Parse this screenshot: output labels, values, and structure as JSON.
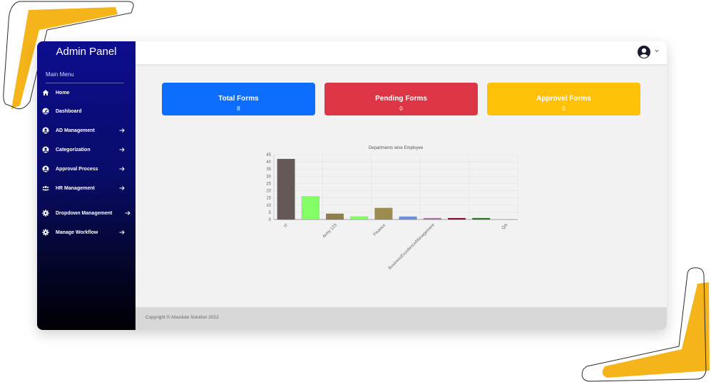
{
  "sidebar": {
    "brand": "Admin Panel",
    "menu_heading": "Main Menu",
    "items": [
      {
        "label": "Home",
        "icon": "home-icon",
        "has_arrow": false
      },
      {
        "label": "Dashboard",
        "icon": "dashboard-icon",
        "has_arrow": false
      },
      {
        "label": "AD Management",
        "icon": "user-circle-icon",
        "has_arrow": true
      },
      {
        "label": "Categorization",
        "icon": "user-circle-icon",
        "has_arrow": true
      },
      {
        "label": "Approval Process",
        "icon": "user-circle-icon",
        "has_arrow": true
      },
      {
        "label": "HR Management",
        "icon": "users-icon",
        "has_arrow": true
      },
      {
        "label": "Dropdown Management",
        "icon": "gear-icon",
        "has_arrow": true
      },
      {
        "label": "Manage Workflow",
        "icon": "gear-icon",
        "has_arrow": true
      }
    ]
  },
  "cards": [
    {
      "title": "Total Forms",
      "count": "8",
      "color": "#0d6efd"
    },
    {
      "title": "Pending Forms",
      "count": "0",
      "color": "#dc3545"
    },
    {
      "title": "Approvel Forms",
      "count": "0",
      "color": "#ffc107"
    }
  ],
  "chart_data": {
    "type": "bar",
    "title": "Departments wise Employee",
    "xlabel": "",
    "ylabel": "",
    "ylim": [
      0,
      45
    ],
    "yticks": [
      0,
      5,
      10,
      15,
      20,
      25,
      30,
      35,
      40,
      45
    ],
    "grid": true,
    "categories": [
      "IT",
      "",
      "Army 123",
      "",
      "Finance",
      "",
      "BusinessExcellenceManagement",
      "",
      "",
      "QA"
    ],
    "values": [
      42,
      16,
      4,
      2,
      8,
      2,
      1,
      1,
      1,
      0
    ],
    "colors": [
      "#675858",
      "#82ff66",
      "#8f7f4c",
      "#82ff66",
      "#9c8c50",
      "#6e8fe0",
      "#b07ab0",
      "#8a0f32",
      "#2f7a1f",
      "#555555"
    ]
  },
  "footer": {
    "copyright": "Copyright © Absolute Solution 2022"
  }
}
